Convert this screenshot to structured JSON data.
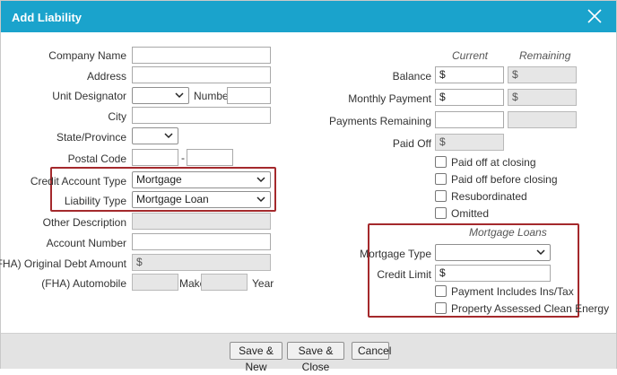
{
  "dialog": {
    "title": "Add Liability"
  },
  "left": {
    "company_name_label": "Company Name",
    "address_label": "Address",
    "unit_designator_label": "Unit Designator",
    "number_label": "Number",
    "city_label": "City",
    "state_label": "State/Province",
    "postal_code_label": "Postal Code",
    "postal_dash": "-",
    "credit_account_type_label": "Credit Account Type",
    "credit_account_type_value": "Mortgage",
    "liability_type_label": "Liability Type",
    "liability_type_value": "Mortgage Loan",
    "other_description_label": "Other Description",
    "account_number_label": "Account Number",
    "fha_original_debt_label": "(FHA) Original Debt Amount",
    "fha_original_debt_value": "$",
    "fha_automobile_label": "(FHA) Automobile",
    "make_label": "Make",
    "year_label": "Year"
  },
  "right": {
    "current_header": "Current",
    "remaining_header": "Remaining",
    "balance_label": "Balance",
    "balance_current": "$",
    "balance_remaining": "$",
    "monthly_payment_label": "Monthly Payment",
    "monthly_payment_current": "$",
    "monthly_payment_remaining": "$",
    "payments_remaining_label": "Payments Remaining",
    "paid_off_label": "Paid Off",
    "paid_off_value": "$",
    "checkboxes": {
      "paid_off_at_closing": "Paid off at closing",
      "paid_off_before_closing": "Paid off before closing",
      "resubordinated": "Resubordinated",
      "omitted": "Omitted"
    },
    "mortgage_loans_header": "Mortgage Loans",
    "mortgage_type_label": "Mortgage Type",
    "credit_limit_label": "Credit Limit",
    "credit_limit_value": "$",
    "payment_includes_label": "Payment Includes Ins/Tax",
    "pace_label": "Property Assessed Clean Energy"
  },
  "footer": {
    "save_new": "Save & New",
    "save_close": "Save & Close",
    "cancel": "Cancel"
  },
  "colors": {
    "title_bar": "#1aa3cc",
    "highlight": "#a4292c"
  }
}
